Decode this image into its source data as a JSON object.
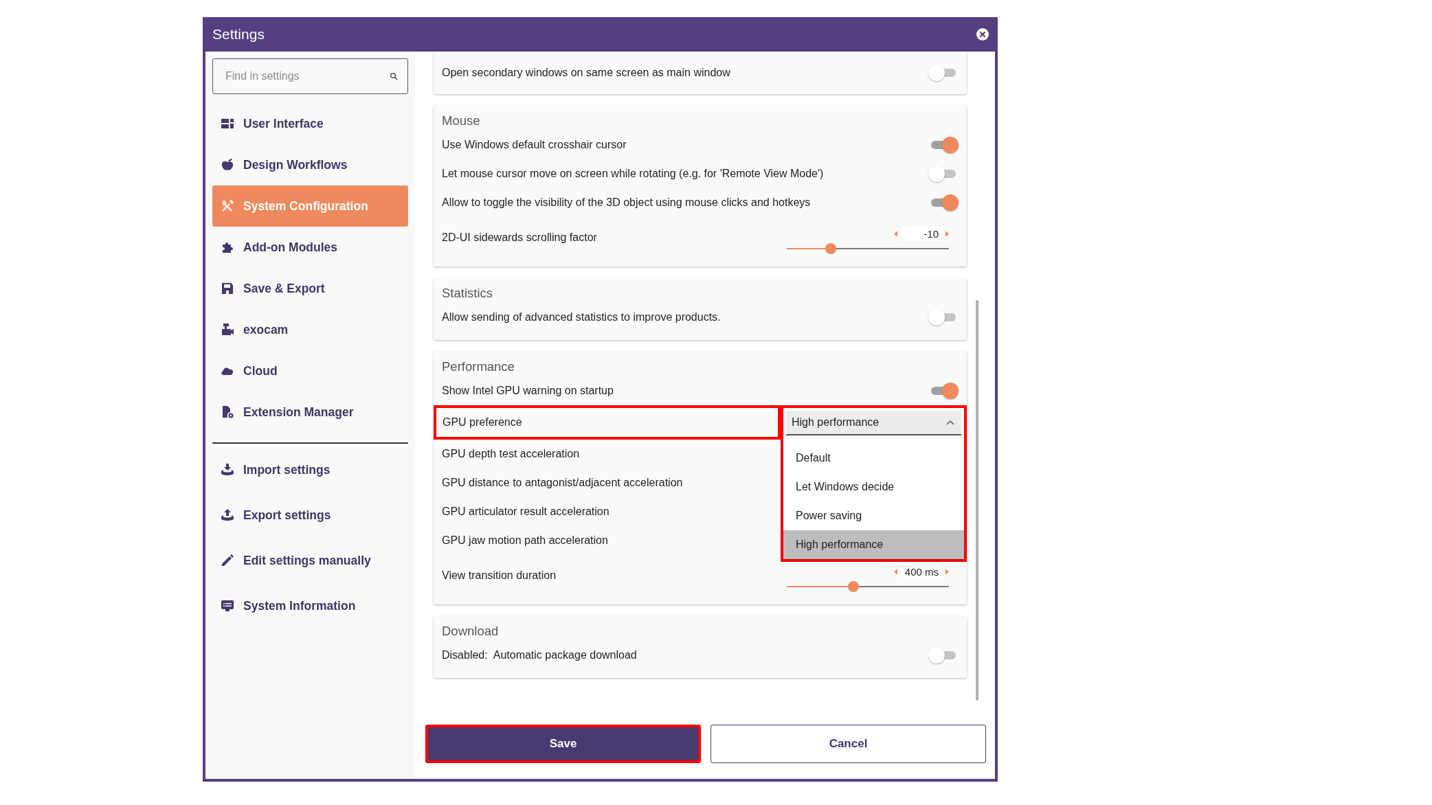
{
  "window": {
    "title": "Settings"
  },
  "sidebar": {
    "search": {
      "placeholder": "Find in settings"
    },
    "items": [
      {
        "label": "User Interface",
        "selected": false
      },
      {
        "label": "Design Workflows",
        "selected": false
      },
      {
        "label": "System Configuration",
        "selected": true
      },
      {
        "label": "Add-on Modules",
        "selected": false
      },
      {
        "label": "Save & Export",
        "selected": false
      },
      {
        "label": "exocam",
        "selected": false
      },
      {
        "label": "Cloud",
        "selected": false
      },
      {
        "label": "Extension Manager",
        "selected": false
      }
    ],
    "tools": [
      {
        "label": "Import settings"
      },
      {
        "label": "Export settings"
      },
      {
        "label": "Edit settings manually"
      },
      {
        "label": "System Information"
      }
    ]
  },
  "content": {
    "sections": [
      {
        "rows": [
          {
            "kind": "toggle",
            "label": "Open secondary windows on same screen as main window",
            "on": false
          }
        ]
      },
      {
        "heading": "Mouse",
        "rows": [
          {
            "kind": "toggle",
            "label": "Use Windows default crosshair cursor",
            "on": true
          },
          {
            "kind": "toggle",
            "label": "Let mouse cursor move on screen while rotating (e.g. for 'Remote View Mode')",
            "on": false
          },
          {
            "kind": "toggle",
            "label": "Allow to toggle the visibility of the 3D object using mouse clicks and hotkeys",
            "on": true
          },
          {
            "kind": "slider",
            "label": "2D-UI sidewards scrolling factor",
            "value": "-10",
            "level": 0.27
          }
        ]
      },
      {
        "heading": "Statistics",
        "rows": [
          {
            "kind": "toggle",
            "label": "Allow sending of advanced statistics to improve products.",
            "on": false
          }
        ]
      },
      {
        "heading": "Performance",
        "rows": [
          {
            "kind": "toggle",
            "label": "Show Intel GPU warning on startup",
            "on": true
          },
          {
            "kind": "select",
            "label": "GPU preference",
            "value": "High performance",
            "expanded": true,
            "highlighted": true,
            "options": [
              {
                "label": "Default",
                "selected": false
              },
              {
                "label": "Let Windows decide",
                "selected": false
              },
              {
                "label": "Power saving",
                "selected": false
              },
              {
                "label": "High performance",
                "selected": true
              }
            ]
          },
          {
            "kind": "plain",
            "label": "GPU depth test acceleration"
          },
          {
            "kind": "plain",
            "label": "GPU distance to antagonist/adjacent acceleration"
          },
          {
            "kind": "plain",
            "label": "GPU articulator result acceleration"
          },
          {
            "kind": "plain",
            "label": "GPU jaw motion path acceleration"
          },
          {
            "kind": "slider",
            "label": "View transition duration",
            "value": "400 ms",
            "level": 0.41
          }
        ]
      },
      {
        "heading": "Download",
        "rows": [
          {
            "kind": "toggle",
            "label": "Disabled:  Automatic package download",
            "on": false
          }
        ]
      }
    ]
  },
  "buttons": [
    {
      "label": "Save",
      "kind": "primary",
      "highlighted": true
    },
    {
      "label": "Cancel",
      "kind": "secondary",
      "highlighted": false
    }
  ]
}
